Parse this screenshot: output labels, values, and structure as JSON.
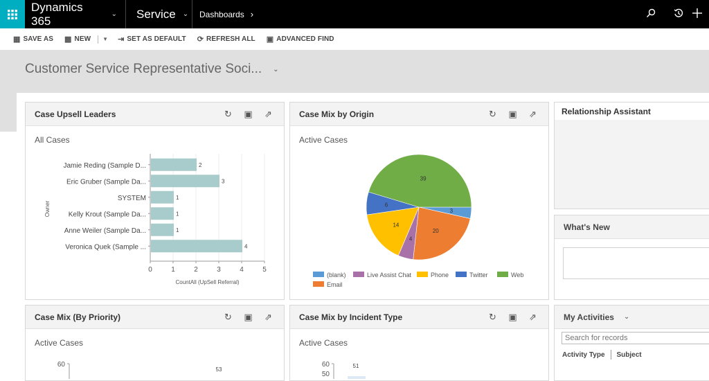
{
  "topbar": {
    "app_title": "Dynamics 365",
    "module": "Service",
    "breadcrumb": "Dashboards",
    "icons": [
      "waffle-icon",
      "search-icon",
      "recent-history-icon",
      "plus-icon"
    ]
  },
  "commandbar": {
    "save_as": "SAVE AS",
    "new": "NEW",
    "set_as_default": "SET AS DEFAULT",
    "refresh_all": "REFRESH ALL",
    "advanced_find": "ADVANCED FIND"
  },
  "dashboard": {
    "title": "Customer Service Representative Soci..."
  },
  "colors": {
    "waffle_bg": "#00aec1",
    "bar_fill": "#a8cbcb",
    "pie_blank": "#5b9bd5",
    "pie_live_assist": "#a872a8",
    "pie_phone": "#ffc000",
    "pie_twitter": "#4472c4",
    "pie_web": "#70ad47",
    "pie_email": "#ed7d31"
  },
  "panels": {
    "upsell": {
      "title": "Case Upsell Leaders",
      "view": "All Cases"
    },
    "origin": {
      "title": "Case Mix by Origin",
      "view": "Active Cases"
    },
    "priority": {
      "title": "Case Mix (By Priority)",
      "view": "Active Cases"
    },
    "incident": {
      "title": "Case Mix by Incident Type",
      "view": "Active Cases"
    },
    "relationship": {
      "title": "Relationship Assistant"
    },
    "whatsnew": {
      "title": "What's New"
    },
    "activities": {
      "title": "My Activities",
      "search_placeholder": "Search for records",
      "columns": [
        "Activity Type",
        "Subject"
      ]
    }
  },
  "chart_data": [
    {
      "type": "bar",
      "orientation": "horizontal",
      "title": "Case Upsell Leaders",
      "categories": [
        "Jamie Reding (Sample D...",
        "Eric Gruber (Sample Da...",
        "SYSTEM",
        "Kelly Krout (Sample Da...",
        "Anne Weiler (Sample Da...",
        "Veronica Quek (Sample ..."
      ],
      "values": [
        2,
        3,
        1,
        1,
        1,
        4
      ],
      "xlabel": "CountAll (UpSell Referral)",
      "ylabel": "Owner",
      "xlim": [
        0,
        5
      ],
      "xticks": [
        "0",
        "1",
        "2",
        "3",
        "4",
        "5"
      ],
      "grid": true
    },
    {
      "type": "pie",
      "title": "Case Mix by Origin",
      "slices": [
        {
          "label": "(blank)",
          "value": 3
        },
        {
          "label": "Email",
          "value": 20
        },
        {
          "label": "Live Assist Chat",
          "value": 4
        },
        {
          "label": "Phone",
          "value": 14
        },
        {
          "label": "Twitter",
          "value": 6
        },
        {
          "label": "Web",
          "value": 39
        }
      ],
      "legend": [
        "(blank)",
        "Live Assist Chat",
        "Phone",
        "Twitter",
        "Web",
        "Email"
      ],
      "legend_position": "bottom"
    },
    {
      "type": "bar",
      "title": "Case Mix (By Priority)",
      "yticks_visible": [
        "60"
      ],
      "visible_data_labels": [
        "53"
      ]
    },
    {
      "type": "bar",
      "title": "Case Mix by Incident Type",
      "yticks_visible": [
        "60",
        "50"
      ],
      "visible_data_labels": [
        "51"
      ]
    }
  ]
}
